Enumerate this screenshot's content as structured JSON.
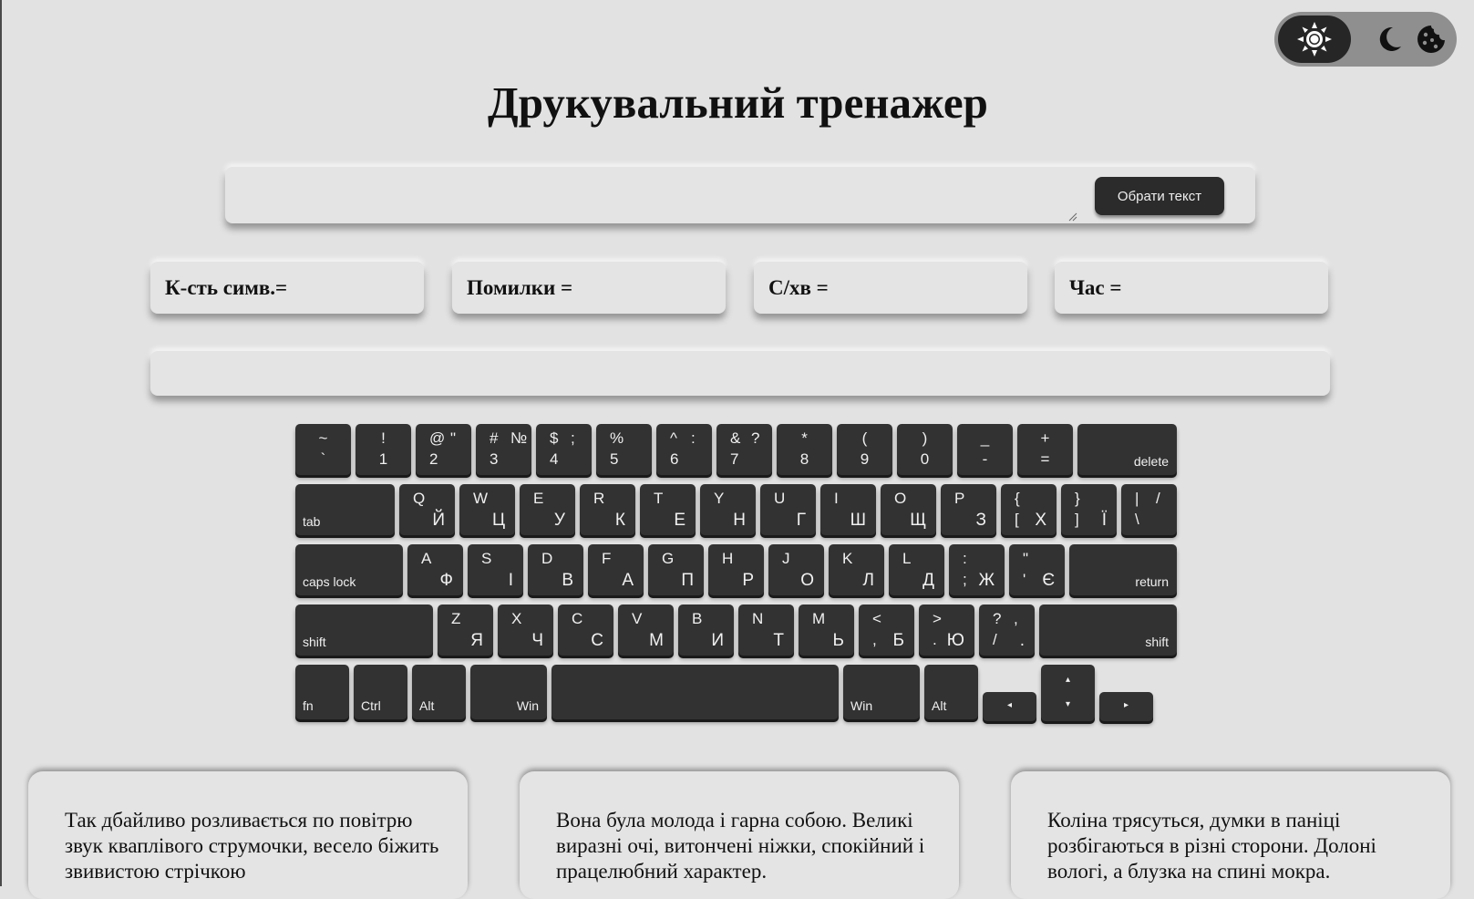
{
  "title": "Друкувальний тренажер",
  "theme_switch": {
    "options": [
      "sun-icon",
      "moon-icon",
      "cookie-icon"
    ],
    "active": "sun-icon"
  },
  "input": {
    "value": "",
    "choose_button": "Обрати текст"
  },
  "stats": [
    {
      "label": "К-сть симв.=",
      "value": ""
    },
    {
      "label": "Помилки =",
      "value": ""
    },
    {
      "label": "С/хв =",
      "value": ""
    },
    {
      "label": "Час =",
      "value": ""
    }
  ],
  "progress": {
    "text": ""
  },
  "keyboard": {
    "row1": [
      {
        "c1": "~",
        "c2": "`"
      },
      {
        "c1": "!",
        "c2": "1"
      },
      {
        "tl": "@",
        "tr": "\"",
        "bl": "2"
      },
      {
        "tl": "#",
        "tr": "№",
        "bl": "3"
      },
      {
        "tl": "$",
        "tr": ";",
        "bl": "4"
      },
      {
        "tl": "%",
        "tr": "",
        "bl": "5"
      },
      {
        "tl": "^",
        "tr": ":",
        "bl": "6"
      },
      {
        "tl": "&",
        "tr": "?",
        "bl": "7"
      },
      {
        "c1": "*",
        "c2": "8"
      },
      {
        "c1": "(",
        "c2": "9"
      },
      {
        "c1": ")",
        "c2": "0"
      },
      {
        "c1": "_",
        "c2": "-"
      },
      {
        "c1": "+",
        "c2": "="
      },
      {
        "lab": "delete"
      }
    ],
    "row2": [
      {
        "lab": "tab"
      },
      {
        "tl": "Q",
        "br": "Й"
      },
      {
        "tl": "W",
        "br": "Ц"
      },
      {
        "tl": "E",
        "br": "У"
      },
      {
        "tl": "R",
        "br": "К"
      },
      {
        "tl": "T",
        "br": "Е"
      },
      {
        "tl": "Y",
        "br": "Н"
      },
      {
        "tl": "U",
        "br": "Г"
      },
      {
        "tl": "I",
        "br": "Ш"
      },
      {
        "tl": "O",
        "br": "Щ"
      },
      {
        "tl": "P",
        "br": "З"
      },
      {
        "tl": "{",
        "bl": "[",
        "br": "Х"
      },
      {
        "tl": "}",
        "bl": "]",
        "br": "Ї"
      },
      {
        "tl": "|",
        "tr": "/",
        "bl": "\\"
      }
    ],
    "row3": [
      {
        "lab": "caps lock"
      },
      {
        "tl": "A",
        "br": "Ф"
      },
      {
        "tl": "S",
        "br": "І"
      },
      {
        "tl": "D",
        "br": "В"
      },
      {
        "tl": "F",
        "br": "А"
      },
      {
        "tl": "G",
        "br": "П"
      },
      {
        "tl": "H",
        "br": "Р"
      },
      {
        "tl": "J",
        "br": "О"
      },
      {
        "tl": "K",
        "br": "Л"
      },
      {
        "tl": "L",
        "br": "Д"
      },
      {
        "tl": ":",
        "bl": ";",
        "br": "Ж"
      },
      {
        "tl": "\"",
        "bl": "'",
        "br": "Є"
      },
      {
        "lab": "return"
      }
    ],
    "row4": [
      {
        "lab": "shift"
      },
      {
        "tl": "Z",
        "br": "Я"
      },
      {
        "tl": "X",
        "br": "Ч"
      },
      {
        "tl": "C",
        "br": "С"
      },
      {
        "tl": "V",
        "br": "М"
      },
      {
        "tl": "B",
        "br": "И"
      },
      {
        "tl": "N",
        "br": "Т"
      },
      {
        "tl": "M",
        "br": "Ь"
      },
      {
        "tl": "<",
        "bl": ",",
        "br": "Б"
      },
      {
        "tl": ">",
        "bl": ".",
        "br": "Ю"
      },
      {
        "tl": "?",
        "tr": ",",
        "bl": "/",
        "br2": "."
      },
      {
        "lab": "shift"
      }
    ],
    "row5": {
      "fn": "fn",
      "ctrl": "Ctrl",
      "alt_left": "Alt",
      "win_left": "Win",
      "win_right": "Win",
      "alt_right": "Alt",
      "left_arrow": "◂",
      "up_arrow": "▴",
      "down_arrow": "▾",
      "right_arrow": "▸"
    }
  },
  "texts": [
    "Так дбайливо розливається по повітрю звук кваплівого струмочки, весело біжить звивистою стрічкою",
    "Вона була молода і гарна собою. Великі виразні очі, витончені ніжки, спокійний і працелюбний характер.",
    "Коліна трясуться, думки в паніці розбігаються в різні сторони. Долоні вологі, а блузка на спині мокра."
  ]
}
